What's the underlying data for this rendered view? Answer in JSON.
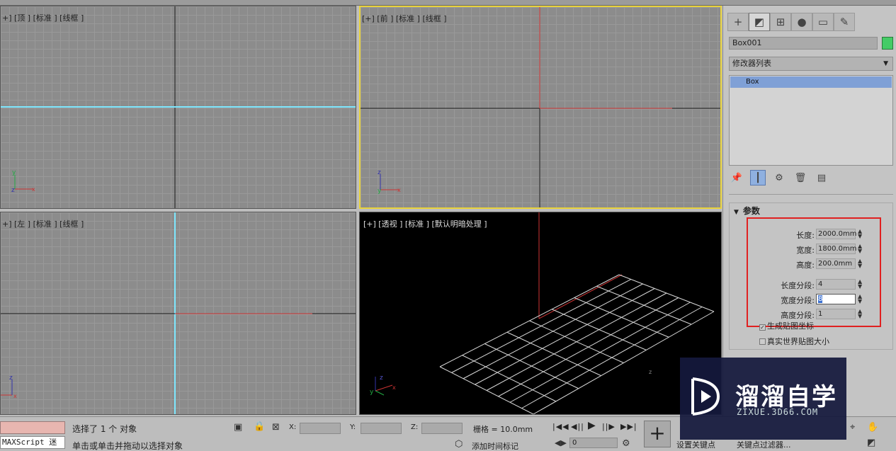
{
  "viewports": {
    "top": {
      "label": "+] [顶 ] [标准 ] [线框 ]"
    },
    "front": {
      "label": "[+] [前 ] [标准 ] [线框 ]"
    },
    "left": {
      "label": "+] [左 ] [标准 ] [线框 ]"
    },
    "perspective": {
      "label": "[+] [透视 ] [标准 ] [默认明暗处理 ]"
    }
  },
  "command_panel": {
    "tabs": [
      "create-icon",
      "modify-icon",
      "hierarchy-icon",
      "motion-icon",
      "display-icon",
      "utilities-icon"
    ],
    "active_tab": "modify-icon",
    "object_name": "Box001",
    "object_color": "#44cc66",
    "modifier_list": "修改器列表",
    "stack_item": "Box",
    "rollout_title": "参数",
    "params": {
      "length_label": "长度:",
      "length_value": "2000.0mm",
      "width_label": "宽度:",
      "width_value": "1800.0mm",
      "height_label": "高度:",
      "height_value": "200.0mm",
      "length_segs_label": "长度分段:",
      "length_segs_value": "4",
      "width_segs_label": "宽度分段:",
      "width_segs_value": "8",
      "height_segs_label": "高度分段:",
      "height_segs_value": "1"
    },
    "gen_mapping": "生成贴图坐标",
    "real_world": "真实世界贴图大小"
  },
  "status": {
    "maxscript": "MAXScript 迷",
    "selection": "选择了 1 个 对象",
    "prompt": "单击或单击并拖动以选择对象",
    "x_label": "X:",
    "y_label": "Y:",
    "z_label": "Z:",
    "grid": "栅格 = 10.0mm",
    "add_time_tag": "添加时间标记",
    "frame": "0",
    "set_key": "设置关键点",
    "key_filters": "关键点过滤器..."
  },
  "watermark": {
    "title": "溜溜自学",
    "url": "ZIXUE.3D66.COM"
  },
  "colors": {
    "active_border": "#e8d23a",
    "highlight_box": "#e02020",
    "selected_cyan": "#7ee8ff"
  }
}
